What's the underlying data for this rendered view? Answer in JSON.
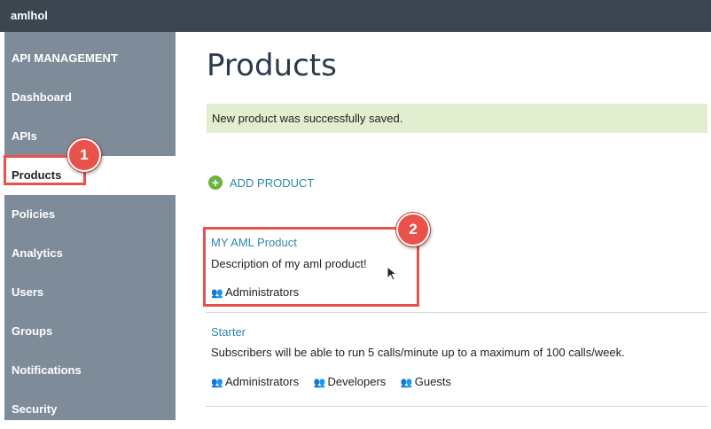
{
  "window": {
    "title": "amlhol"
  },
  "sidebar": {
    "header": "API MANAGEMENT",
    "items": [
      {
        "label": "Dashboard"
      },
      {
        "label": "APIs"
      },
      {
        "label": "Products",
        "active": true
      },
      {
        "label": "Policies"
      },
      {
        "label": "Analytics"
      },
      {
        "label": "Users"
      },
      {
        "label": "Groups"
      },
      {
        "label": "Notifications"
      },
      {
        "label": "Security"
      }
    ]
  },
  "callouts": {
    "one": "1",
    "two": "2"
  },
  "main": {
    "title": "Products",
    "success_message": "New product was successfully saved.",
    "add_product": "ADD PRODUCT",
    "products": [
      {
        "name": "MY AML Product",
        "description": "Description of my aml product!",
        "groups": [
          "Administrators"
        ]
      },
      {
        "name": "Starter",
        "description": "Subscribers will be able to run 5 calls/minute up to a maximum of 100 calls/week.",
        "groups": [
          "Administrators",
          "Developers",
          "Guests"
        ]
      }
    ]
  },
  "colors": {
    "accent": "#2f86a8",
    "annotation": "#e8524a",
    "success_bg": "#e2eecf",
    "sidebar_bg": "#7e8c99"
  },
  "icons": {
    "add": "plus-circle-icon",
    "group": "users-icon"
  }
}
